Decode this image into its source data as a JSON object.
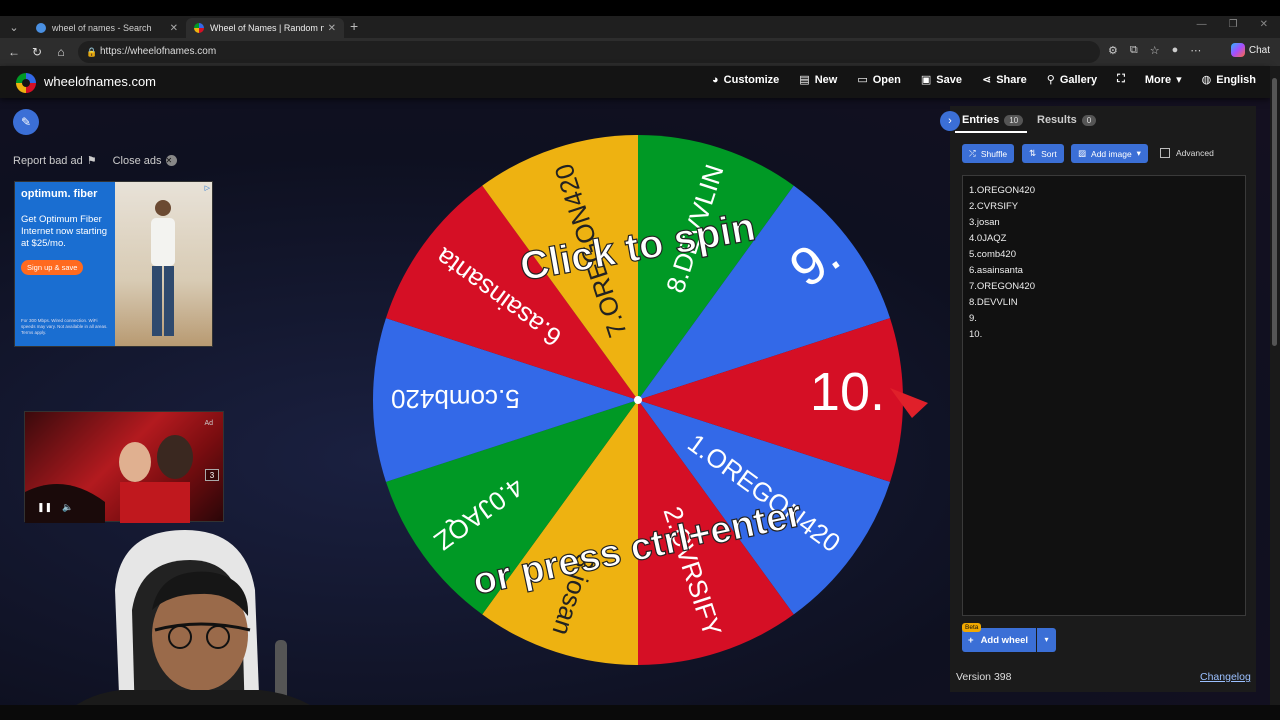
{
  "browser": {
    "tabs": [
      {
        "label": "wheel of names - Search",
        "favicon_color": "#4a90e2"
      },
      {
        "label": "Wheel of Names | Random name",
        "favicon_color": "#e0452b"
      }
    ],
    "url": "https://wheelofnames.com",
    "chat_label": "Chat"
  },
  "site": {
    "title": "wheelofnames.com",
    "menu": [
      {
        "label": "Customize",
        "icon": "palette-icon"
      },
      {
        "label": "New",
        "icon": "file-icon"
      },
      {
        "label": "Open",
        "icon": "folder-icon"
      },
      {
        "label": "Save",
        "icon": "save-icon"
      },
      {
        "label": "Share",
        "icon": "share-icon"
      },
      {
        "label": "Gallery",
        "icon": "search-icon"
      },
      {
        "label": "",
        "icon": "fullscreen-icon"
      },
      {
        "label": "More",
        "icon": "chevron-down-icon"
      },
      {
        "label": "English",
        "icon": "globe-icon"
      }
    ]
  },
  "ads": {
    "report_label": "Report bad ad",
    "close_label": "Close ads",
    "fiber": {
      "brand": "optimum. fiber",
      "headline": "Get Optimum Fiber Internet now starting at $25/mo.",
      "cta": "Sign up & save",
      "fine_print": "For 300 Mbps. Wired connection. WiFi speeds may vary. Not available in all areas. Terms apply."
    },
    "video": {
      "counter": "3"
    }
  },
  "wheel": {
    "segments": [
      {
        "label": "1.OREGON420",
        "color": "#3369e8"
      },
      {
        "label": "2.CVRSIFY",
        "color": "#d50f25"
      },
      {
        "label": "3.josan",
        "color": "#eeb211"
      },
      {
        "label": "4.0JAQZ",
        "color": "#009925"
      },
      {
        "label": "5.comb420",
        "color": "#3369e8"
      },
      {
        "label": "6.asainsanta",
        "color": "#d50f25"
      },
      {
        "label": "7.OREGON420",
        "color": "#eeb211"
      },
      {
        "label": "8.DEVVLIN",
        "color": "#009925"
      },
      {
        "label": "9.",
        "color": "#3369e8"
      },
      {
        "label": "10.",
        "color": "#d50f25"
      }
    ],
    "prompt_top": "Click to spin",
    "prompt_bottom": "or press ctrl+enter",
    "pointer_color": "#e0202a"
  },
  "panel": {
    "tabs": [
      {
        "label": "Entries",
        "count": "10"
      },
      {
        "label": "Results",
        "count": "0"
      }
    ],
    "buttons": {
      "shuffle": "Shuffle",
      "sort": "Sort",
      "add_image": "Add image"
    },
    "advanced_label": "Advanced",
    "entries": [
      "1.OREGON420",
      "2.CVRSIFY",
      "3.josan",
      "4.0JAQZ",
      "5.comb420",
      "6.asainsanta",
      "7.OREGON420",
      "8.DEVVLIN",
      "9.",
      "10."
    ],
    "beta_label": "Beta",
    "add_wheel_label": "Add wheel",
    "version": "Version 398",
    "changelog": "Changelog"
  }
}
